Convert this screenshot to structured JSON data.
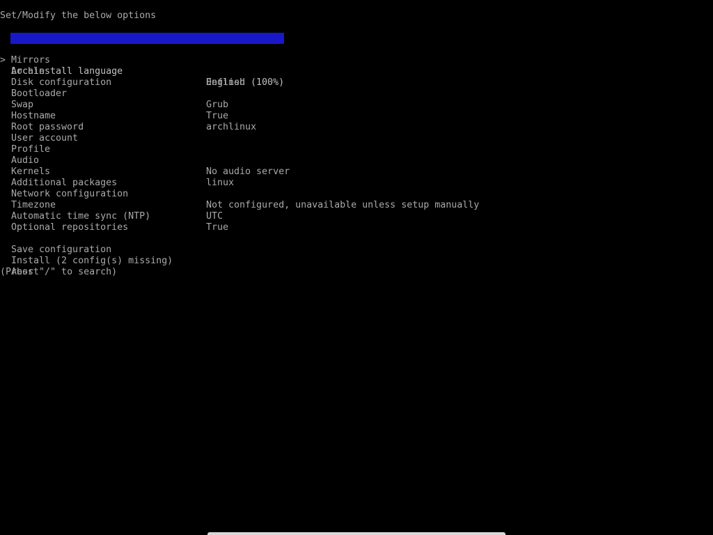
{
  "title": "Set/Modify the below options",
  "cursor_glyph": ">",
  "highlight_color": "#1818c8",
  "menu": [
    {
      "label": "Archinstall language",
      "value": "English (100%)",
      "selected": true
    },
    {
      "label": "Mirrors",
      "value": ""
    },
    {
      "label": "Locales",
      "value": "Defined"
    },
    {
      "label": "Disk configuration",
      "value": ""
    },
    {
      "label": "Bootloader",
      "value": "Grub"
    },
    {
      "label": "Swap",
      "value": "True"
    },
    {
      "label": "Hostname",
      "value": "archlinux"
    },
    {
      "label": "Root password",
      "value": ""
    },
    {
      "label": "User account",
      "value": ""
    },
    {
      "label": "Profile",
      "value": ""
    },
    {
      "label": "Audio",
      "value": "No audio server"
    },
    {
      "label": "Kernels",
      "value": "linux"
    },
    {
      "label": "Additional packages",
      "value": ""
    },
    {
      "label": "Network configuration",
      "value": "Not configured, unavailable unless setup manually"
    },
    {
      "label": "Timezone",
      "value": "UTC"
    },
    {
      "label": "Automatic time sync (NTP)",
      "value": "True"
    },
    {
      "label": "Optional repositories",
      "value": ""
    }
  ],
  "actions": [
    {
      "label": "Save configuration"
    },
    {
      "label": "Install (2 config(s) missing)"
    },
    {
      "label": "Abort"
    }
  ],
  "search_hint": "(Press \"/\" to search)"
}
